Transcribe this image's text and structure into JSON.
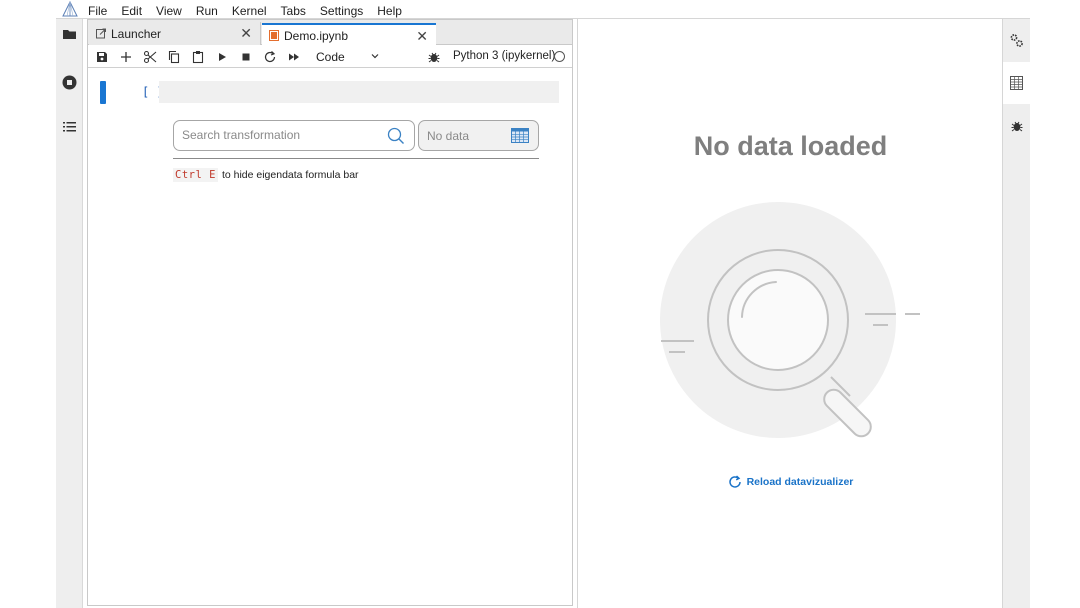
{
  "menu": {
    "items": [
      "File",
      "Edit",
      "View",
      "Run",
      "Kernel",
      "Tabs",
      "Settings",
      "Help"
    ]
  },
  "left_sidebar": {
    "icons": [
      "folder-icon",
      "running-stop-icon",
      "toc-list-icon"
    ]
  },
  "tabs": [
    {
      "label": "Launcher",
      "icon": "launcher-icon",
      "active": false
    },
    {
      "label": "Demo.ipynb",
      "icon": "notebook-icon",
      "active": true
    }
  ],
  "toolbar": {
    "cell_type": "Code",
    "kernel_name": "Python 3 (ipykernel)"
  },
  "cell": {
    "prompt": "[ ]:"
  },
  "transform": {
    "search_placeholder": "Search transformation",
    "data_label": "No data",
    "hint_key": "Ctrl E",
    "hint_text": "to hide eigendata formula bar"
  },
  "data_panel": {
    "title": "No data loaded",
    "reload_label": "Reload datavizualizer"
  },
  "colors": {
    "accent": "#1976d2",
    "link": "#1a73c8",
    "title_gray": "#7f7f7f"
  }
}
